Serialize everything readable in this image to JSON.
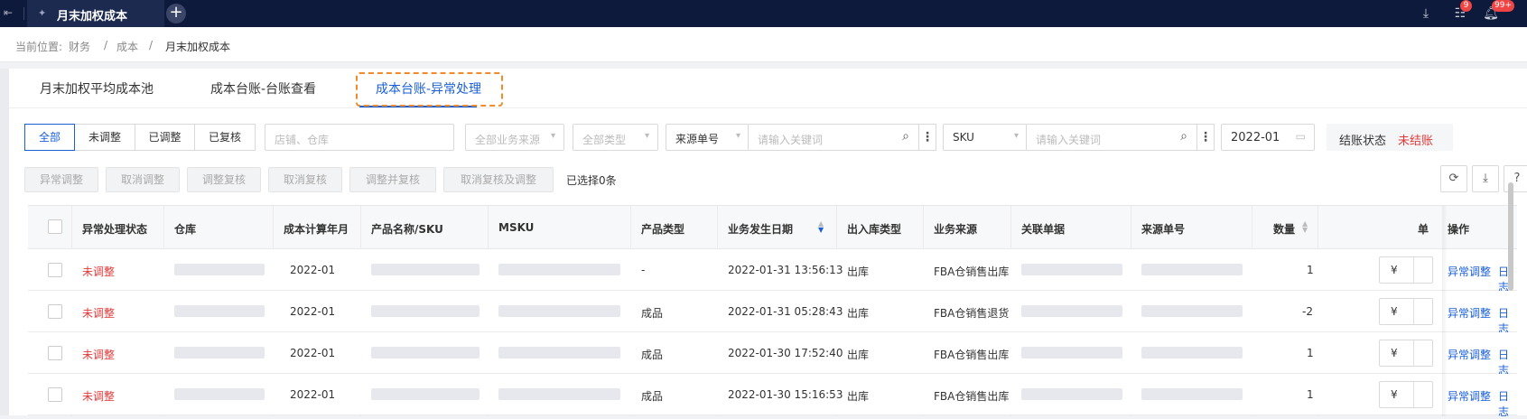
{
  "topbar": {
    "tab_title": "月末加权成本",
    "notif_count_tasks": "9",
    "notif_count_bell": "99+"
  },
  "breadcrumb": {
    "label": "当前位置:",
    "items": [
      "财务",
      "成本",
      "月末加权成本"
    ]
  },
  "subtabs": [
    {
      "label": "月末加权平均成本池"
    },
    {
      "label": "成本台账-台账查看"
    },
    {
      "label": "成本台账-异常处理"
    }
  ],
  "filters": {
    "status_seg": [
      "全部",
      "未调整",
      "已调整",
      "已复核"
    ],
    "store_placeholder": "店铺、仓库",
    "biz_source_placeholder": "全部业务来源",
    "type_placeholder": "全部类型",
    "source_no_select": "来源单号",
    "keyword_placeholder": "请输入关键词",
    "sku_select": "SKU",
    "sku_keyword_placeholder": "请输入关键词",
    "month_value": "2022-01",
    "settle_label": "结账状态",
    "settle_value": "未结账"
  },
  "actions": {
    "buttons": [
      "异常调整",
      "取消调整",
      "调整复核",
      "取消复核",
      "调整并复核",
      "取消复核及调整"
    ],
    "selected_text": "已选择0条"
  },
  "table": {
    "headers": [
      "异常处理状态",
      "仓库",
      "成本计算年月",
      "产品名称/SKU",
      "MSKU",
      "产品类型",
      "业务发生日期",
      "出入库类型",
      "业务来源",
      "关联单据",
      "来源单号",
      "数量",
      "单",
      "操作"
    ],
    "currency_symbol": "¥",
    "op_adjust": "异常调整",
    "op_log": "日志",
    "rows": [
      {
        "status": "未调整",
        "month": "2022-01",
        "ptype": "-",
        "date": "2022-01-31 13:56:13",
        "io": "出库",
        "source": "FBA仓销售出库",
        "qty": "1"
      },
      {
        "status": "未调整",
        "month": "2022-01",
        "ptype": "成品",
        "date": "2022-01-31 05:28:43",
        "io": "出库",
        "source": "FBA仓销售退货",
        "qty": "-2"
      },
      {
        "status": "未调整",
        "month": "2022-01",
        "ptype": "成品",
        "date": "2022-01-30 17:52:40",
        "io": "出库",
        "source": "FBA仓销售出库",
        "qty": "1"
      },
      {
        "status": "未调整",
        "month": "2022-01",
        "ptype": "成品",
        "date": "2022-01-30 15:16:53",
        "io": "出库",
        "source": "FBA仓销售出库",
        "qty": "1"
      }
    ]
  }
}
